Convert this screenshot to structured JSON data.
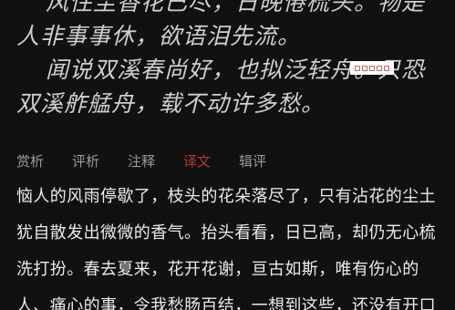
{
  "poem": {
    "lines": [
      "风住尘香花已尽，日晚倦梳头。物是",
      "人非事事休，欲语泪先流。",
      "闻说双溪春尚好，也拟泛轻舟。只恐",
      "双溪舴艋舟，载不动许多愁。"
    ]
  },
  "tabs": [
    {
      "label": "赏析",
      "active": false
    },
    {
      "label": "评析",
      "active": false
    },
    {
      "label": "注释",
      "active": false
    },
    {
      "label": "译文",
      "active": true
    },
    {
      "label": "辑评",
      "active": false
    }
  ],
  "translation": {
    "lines": [
      "恼人的风雨停歇了，枝头的花朵落尽了，只有沾花的尘土",
      "犹自散发出微微的香气。抬头看看，日已高，却仍无心梳",
      "洗打扮。春去夏来，花开花谢，亘古如斯，唯有伤心的",
      "人、痛心的事，令我愁肠百结，一想到这些，还没有开口"
    ]
  },
  "colors": {
    "background": "#111111",
    "poem": "#cfcfcf",
    "text": "#ebebeb",
    "tab": "#9a9a9a",
    "active_tab": "#b8372c"
  }
}
